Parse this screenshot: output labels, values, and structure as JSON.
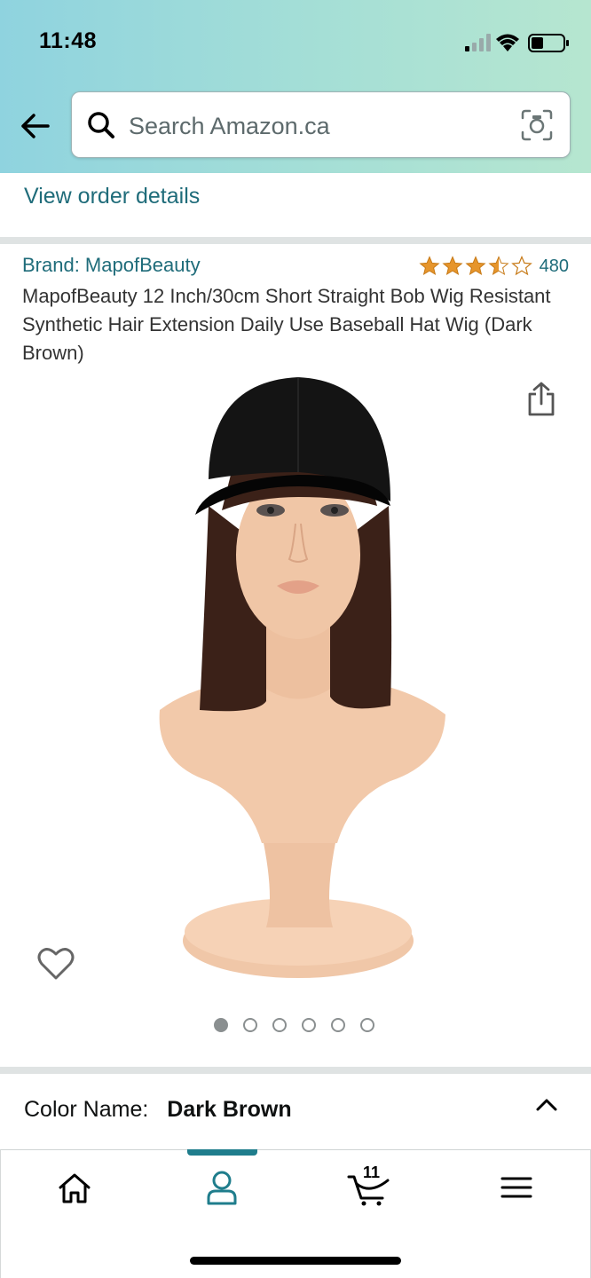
{
  "status_bar": {
    "time": "11:48"
  },
  "search": {
    "placeholder": "Search Amazon.ca"
  },
  "order": {
    "link_label": "View order details"
  },
  "product": {
    "brand_label": "Brand: MapofBeauty",
    "rating": 3.5,
    "rating_count": "480",
    "title": "MapofBeauty 12 Inch/30cm Short Straight Bob Wig Resistant Synthetic Hair Extension Daily Use Baseball Hat Wig (Dark Brown)",
    "image_count": 6,
    "active_image_index": 0
  },
  "color": {
    "label": "Color Name:",
    "value": "Dark Brown"
  },
  "tabbar": {
    "items": [
      {
        "name": "home-icon"
      },
      {
        "name": "account-icon"
      },
      {
        "name": "cart-icon"
      },
      {
        "name": "menu-icon"
      }
    ],
    "cart_count": "11",
    "active_index": 1
  },
  "colors": {
    "link": "#1f6c7a",
    "accent": "#1f7d8c",
    "star": "#e6952c",
    "header_gradient_start": "#8fd3df",
    "header_gradient_end": "#b6e6d0"
  }
}
